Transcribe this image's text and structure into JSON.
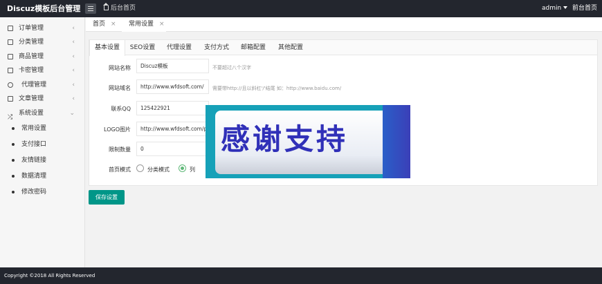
{
  "header": {
    "brand": "Discuz模板后台管理",
    "home_link": "后台首页",
    "user": "admin",
    "front_link": "前台首页"
  },
  "sidebar": {
    "items": [
      {
        "label": "订单管理",
        "icon": "box-icon"
      },
      {
        "label": "分类管理",
        "icon": "list-icon"
      },
      {
        "label": "商品管理",
        "icon": "cube-icon"
      },
      {
        "label": "卡密管理",
        "icon": "card-icon"
      },
      {
        "label": "代理管理",
        "icon": "users-icon"
      },
      {
        "label": "文章管理",
        "icon": "file-icon"
      },
      {
        "label": "系统设置",
        "icon": "shuffle-icon"
      }
    ],
    "subitems": [
      "常用设置",
      "支付接口",
      "友情链接",
      "数据清理",
      "修改密码"
    ]
  },
  "page_tabs": [
    {
      "label": "首页"
    },
    {
      "label": "常用设置"
    }
  ],
  "form_tabs": [
    "基本设置",
    "SEO设置",
    "代理设置",
    "支付方式",
    "邮箱配置",
    "其他配置"
  ],
  "form": {
    "site_name": {
      "label": "网站名称",
      "value": "Discuz模板",
      "hint": "不要超过八个汉字"
    },
    "domain": {
      "label": "网站域名",
      "value": "http://www.wfdsoft.com/",
      "hint": "需要带http://且以斜杠'/'结尾 如：http://www.baidu.com/"
    },
    "qq": {
      "label": "联系QQ",
      "value": "125422921"
    },
    "logo": {
      "label": "LOGO图片",
      "value": "http://www.wfdsoft.com/pu"
    },
    "limit": {
      "label": "限制数量",
      "value": "0"
    },
    "home_mode": {
      "label": "首页模式",
      "option1": "分类模式",
      "option2": "列"
    }
  },
  "banner_text": "感谢支持",
  "save_label": "保存设置",
  "footer": "Copyright ©2018 All Rights Reserved",
  "colors": {
    "primary": "#009688",
    "topbar": "#23262e",
    "radio_on": "#5fb878"
  }
}
